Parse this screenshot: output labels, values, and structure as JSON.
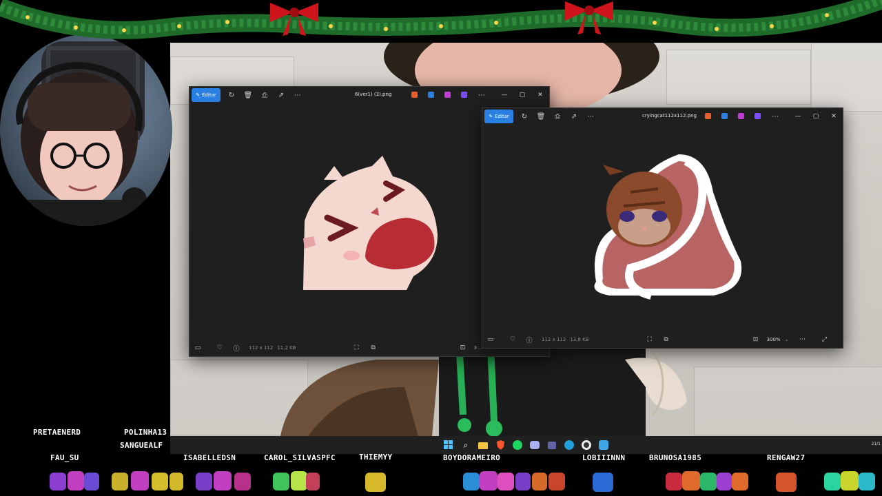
{
  "viewer_left": {
    "edit_label": "Editar",
    "filename": "6(ver1) (3).png",
    "dimensions": "112 x 112",
    "filesize": "11,2 KB",
    "zoom": "3..."
  },
  "viewer_right": {
    "edit_label": "Editar",
    "filename": "cryingcat112x112.png",
    "dimensions": "112 x 112",
    "filesize": "13,8 KB",
    "zoom": "300%"
  },
  "overlay": {
    "names": [
      "PRETAENERD",
      "POLINHA13",
      "SANGUEALF",
      "FAU_SU",
      "ISABELLEDSN",
      "CAROL_SILVASPFC",
      "THIEMYY",
      "BOYDORAMEIRO",
      "LOBIIINNN",
      "BRUNOSA1985",
      "RENGAW27"
    ]
  },
  "taskbar": {
    "clock": "21/1"
  },
  "colors": {
    "edit_blue": "#2a7fe3",
    "viewer_bg": "#1f1f1f",
    "garland_green": "#1f6b2a",
    "bow_red": "#d0141b"
  },
  "icons": [
    "edit-icon",
    "rotate-icon",
    "delete-icon",
    "print-icon",
    "share-icon",
    "more-icon",
    "minimize-icon",
    "maximize-icon",
    "close-icon",
    "filmstrip-icon",
    "favorite-icon",
    "info-icon",
    "fit-icon",
    "crop-icon",
    "fullscreen-icon",
    "windows-start-icon",
    "search-icon"
  ]
}
